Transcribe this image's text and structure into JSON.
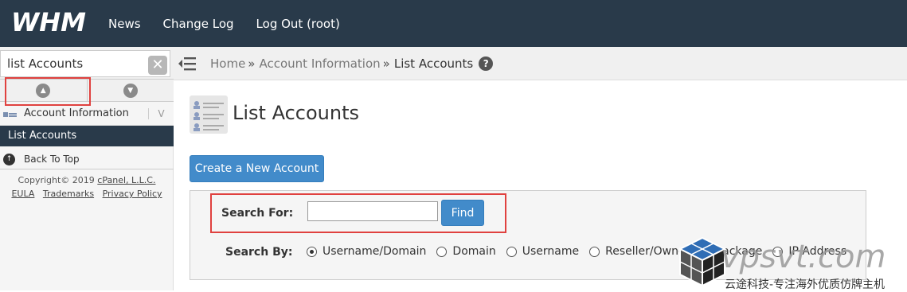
{
  "topbar": {
    "logo": "WHM",
    "nav": [
      "News",
      "Change Log",
      "Log Out (root)"
    ]
  },
  "sidebar": {
    "search_value": "list Accounts",
    "clear_icon": "close-icon",
    "category": "Account Information",
    "active_item": "List Accounts",
    "back_to_top": "Back To Top",
    "copyright": "Copyright© 2019 cPanel, L.L.C.",
    "copyright_prefix": "Copyright© 2019 ",
    "company": "cPanel, L.L.C.",
    "links": [
      "EULA",
      "Trademarks",
      "Privacy Policy"
    ]
  },
  "breadcrumb": {
    "items": [
      "Home",
      "Account Information"
    ],
    "current": "List Accounts",
    "sep": "»"
  },
  "main": {
    "title": "List Accounts",
    "create_button": "Create a New Account",
    "search_for_label": "Search For:",
    "search_value": "",
    "find_button": "Find",
    "search_by_label": "Search By:",
    "search_by_options": [
      "Username/Domain",
      "Domain",
      "Username",
      "Reseller/Owner",
      "Package",
      "IP Address"
    ],
    "search_by_selected": "Username/Domain"
  },
  "watermark": {
    "text": "vpsvt.com",
    "sub": "云途科技-专注海外优质仿牌主机"
  },
  "colors": {
    "topbar": "#293a4a",
    "button": "#428bca",
    "highlight": "#e0413f"
  }
}
